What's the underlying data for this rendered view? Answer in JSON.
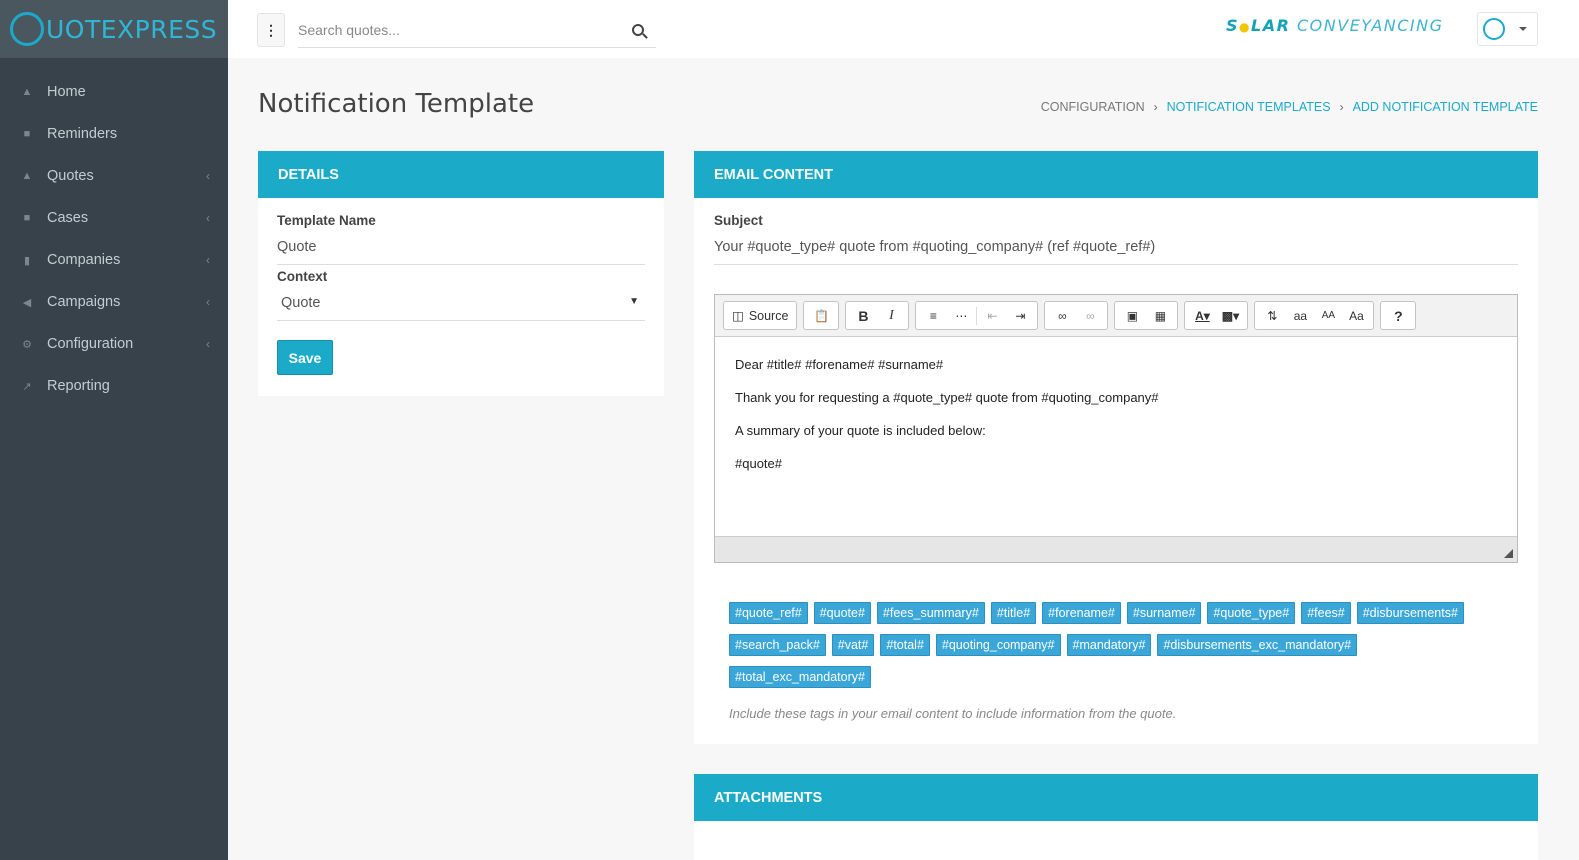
{
  "app": {
    "logo_mark": "Q",
    "logo_text": "UOTEXPRESS"
  },
  "sidebar": {
    "items": [
      {
        "label": "Home",
        "icon": "home-icon",
        "has_children": false
      },
      {
        "label": "Reminders",
        "icon": "book-icon",
        "has_children": false
      },
      {
        "label": "Quotes",
        "icon": "home-icon",
        "has_children": true
      },
      {
        "label": "Cases",
        "icon": "briefcase-icon",
        "has_children": true
      },
      {
        "label": "Companies",
        "icon": "building-icon",
        "has_children": true
      },
      {
        "label": "Campaigns",
        "icon": "bullhorn-icon",
        "has_children": true
      },
      {
        "label": "Configuration",
        "icon": "cogs-icon",
        "has_children": true
      },
      {
        "label": "Reporting",
        "icon": "chart-icon",
        "has_children": false
      }
    ]
  },
  "topbar": {
    "search_placeholder": "Search quotes...",
    "brand_part1": "S",
    "brand_sun": "●",
    "brand_part2": "LAR",
    "brand_part3": " CONVEYANCING"
  },
  "page": {
    "title": "Notification Template",
    "breadcrumb": [
      "CONFIGURATION",
      "NOTIFICATION TEMPLATES",
      "ADD NOTIFICATION TEMPLATE"
    ]
  },
  "details": {
    "heading": "DETAILS",
    "template_name_label": "Template Name",
    "template_name_value": "Quote",
    "context_label": "Context",
    "context_value": "Quote",
    "save_label": "Save"
  },
  "email": {
    "heading": "EMAIL CONTENT",
    "subject_label": "Subject",
    "subject_value": "Your #quote_type# quote from #quoting_company# (ref #quote_ref#)",
    "toolbar": {
      "source_label": "Source"
    },
    "body": [
      "Dear #title# #forename# #surname#",
      "Thank you for requesting a #quote_type# quote from #quoting_company#",
      "A summary of your quote is included below:",
      "#quote#"
    ],
    "tags": [
      "#quote_ref#",
      "#quote#",
      "#fees_summary#",
      "#title#",
      "#forename#",
      "#surname#",
      "#quote_type#",
      "#fees#",
      "#disbursements#",
      "#search_pack#",
      "#vat#",
      "#total#",
      "#quoting_company#",
      "#mandatory#",
      "#disbursements_exc_mandatory#",
      "#total_exc_mandatory#"
    ],
    "hint": "Include these tags in your email content to include information from the quote."
  },
  "attachments": {
    "heading": "ATTACHMENTS"
  }
}
